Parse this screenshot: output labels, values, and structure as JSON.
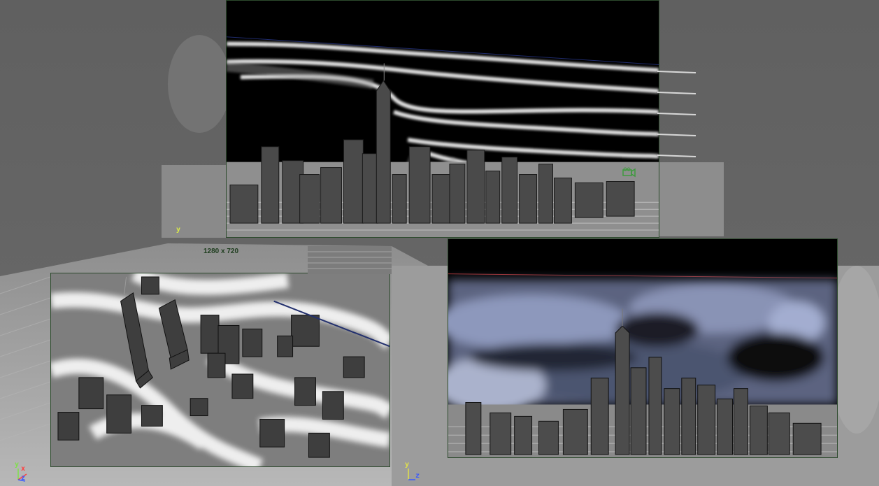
{
  "viewport": {
    "resolution_label": "1280 x 720"
  },
  "axes": {
    "top": {
      "y": "y"
    },
    "bottom_left": {
      "y": "y",
      "x": "x",
      "z": "z"
    },
    "bottom_right": {
      "y": "y",
      "z": "z"
    }
  },
  "panels": {
    "top": {
      "view": "front-perspective",
      "colors": {
        "sky": "#000000",
        "streak": "#f2f2f2",
        "building": "#4a4a4a",
        "grid": "#c8c8c8"
      }
    },
    "bottom_left": {
      "view": "aerial-perspective",
      "colors": {
        "building": "#3e3e3e",
        "flow": "#ffffff",
        "ground": "#8a8a8a"
      }
    },
    "bottom_right": {
      "view": "side-perspective",
      "colors": {
        "sky": "#000000",
        "cloud": "#7b86a8",
        "building": "#4c4c4c"
      }
    }
  },
  "icons": [
    "viewport-axis-icon",
    "camera-icon"
  ]
}
